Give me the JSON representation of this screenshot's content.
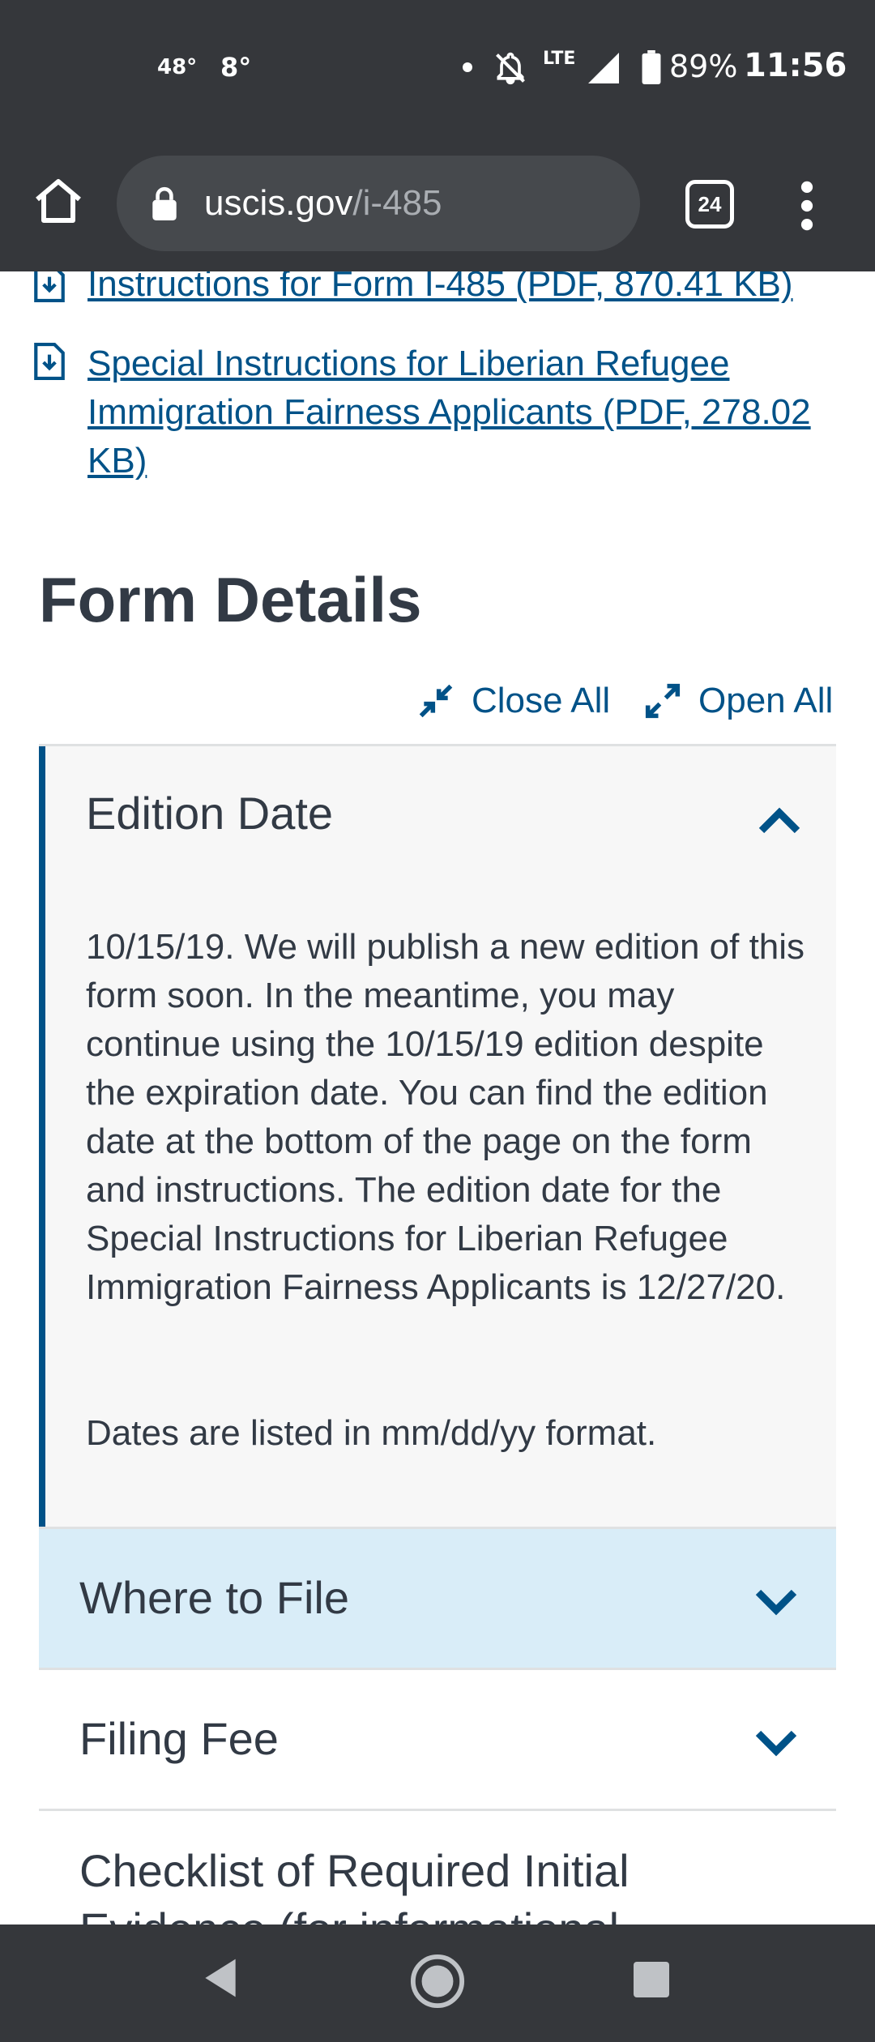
{
  "status_bar": {
    "temp1": "48°",
    "temp2": "8°",
    "network": "LTE",
    "battery_pct": "89%",
    "time": "11:56"
  },
  "browser": {
    "url_host": "uscis.gov",
    "url_path": "/i-485",
    "tab_count": "24"
  },
  "links": [
    {
      "label": "Instructions for Form I-485 (PDF, 870.41 KB)"
    },
    {
      "label": "Special Instructions for Liberian Refugee Immigration Fairness Applicants (PDF, 278.02 KB)"
    }
  ],
  "form_details": {
    "heading": "Form Details",
    "close_all": "Close All",
    "open_all": "Open All",
    "sections": [
      {
        "title": "Edition Date",
        "expanded": true,
        "body": "10/15/19. We will publish a new edition of this form soon. In the meantime, you may continue using the 10/15/19 edition despite the expiration date. You can find the edition date at the bottom of the page on the form and instructions. The edition date for the Special Instructions for Liberian Refugee Immigration Fairness Applicants is 12/27/20.",
        "note": "Dates are listed in mm/dd/yy format."
      },
      {
        "title": "Where to File",
        "expanded": false
      },
      {
        "title": "Filing Fee",
        "expanded": false
      },
      {
        "title": "Checklist of Required Initial Evidence (for informational purposes only)",
        "expanded": false
      }
    ]
  },
  "colors": {
    "link_blue": "#005288",
    "chrome_dark": "#35373b",
    "highlight_row": "#d9edf8",
    "open_panel_bg": "#f7f7f7"
  }
}
